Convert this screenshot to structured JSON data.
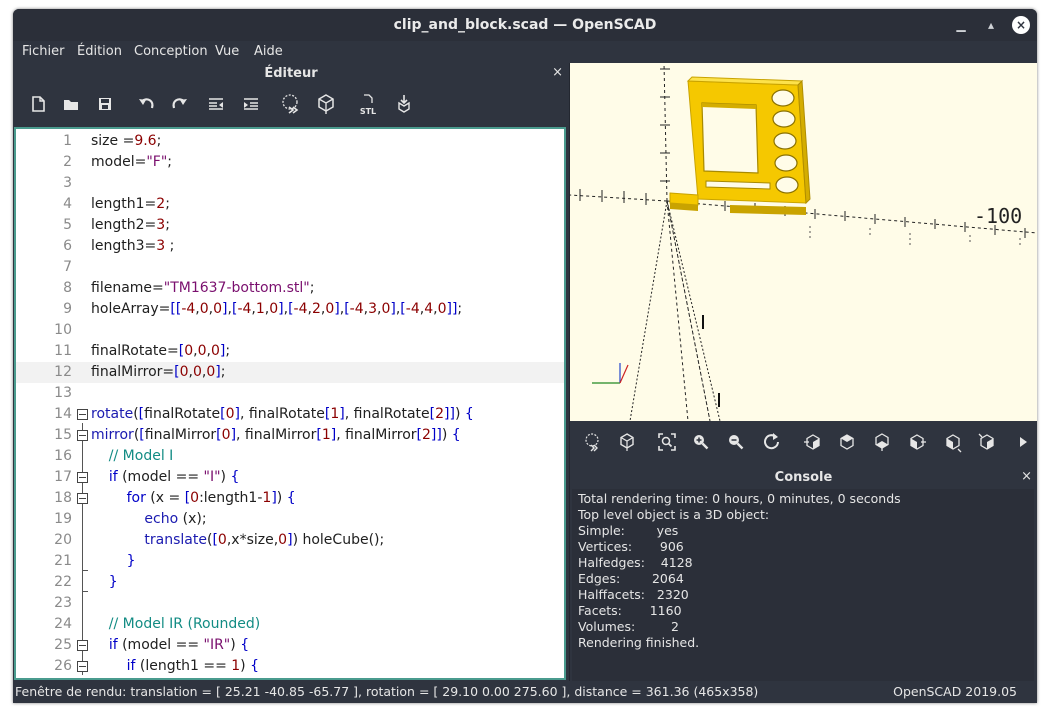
{
  "window": {
    "title": "clip_and_block.scad — OpenSCAD"
  },
  "menu": [
    "Fichier",
    "Édition",
    "Conception",
    "Vue",
    "Aide"
  ],
  "editor": {
    "title": "Éditeur",
    "close": "×",
    "toolbar_icons": [
      "new-file-icon",
      "open-file-icon",
      "save-icon",
      "undo-icon",
      "redo-icon",
      "unindent-icon",
      "indent-icon",
      "preview-icon",
      "render-icon",
      "export-stl-icon",
      "send-to-3d-print-icon"
    ],
    "stl_label": "STL"
  },
  "code_lines": [
    {
      "n": "1",
      "text": "size =9.6;"
    },
    {
      "n": "2",
      "text": "model=\"F\";"
    },
    {
      "n": "3",
      "text": ""
    },
    {
      "n": "4",
      "text": "length1=2;"
    },
    {
      "n": "5",
      "text": "length2=3;"
    },
    {
      "n": "6",
      "text": "length3=3 ;"
    },
    {
      "n": "7",
      "text": ""
    },
    {
      "n": "8",
      "text": "filename=\"TM1637-bottom.stl\";"
    },
    {
      "n": "9",
      "text": "holeArray=[[-4,0,0],[-4,1,0],[-4,2,0],[-4,3,0],[-4,4,0]];"
    },
    {
      "n": "10",
      "text": ""
    },
    {
      "n": "11",
      "text": "finalRotate=[0,0,0];"
    },
    {
      "n": "12",
      "text": "finalMirror=[0,0,0];"
    },
    {
      "n": "13",
      "text": ""
    },
    {
      "n": "14",
      "text": "rotate([finalRotate[0], finalRotate[1], finalRotate[2]]) {"
    },
    {
      "n": "15",
      "text": "mirror([finalMirror[0], finalMirror[1], finalMirror[2]]) {"
    },
    {
      "n": "16",
      "text": "    // Model I"
    },
    {
      "n": "17",
      "text": "    if (model == \"I\") {"
    },
    {
      "n": "18",
      "text": "        for (x = [0:length1-1]) {"
    },
    {
      "n": "19",
      "text": "            echo (x);"
    },
    {
      "n": "20",
      "text": "            translate([0,x*size,0]) holeCube();"
    },
    {
      "n": "21",
      "text": "        }"
    },
    {
      "n": "22",
      "text": "    }"
    },
    {
      "n": "23",
      "text": ""
    },
    {
      "n": "24",
      "text": "    // Model IR (Rounded)"
    },
    {
      "n": "25",
      "text": "    if (model == \"IR\") {"
    },
    {
      "n": "26",
      "text": "        if (length1 == 1) {"
    }
  ],
  "viewport": {
    "axis_label": "-100"
  },
  "view_toolbar_icons": [
    "preview-icon",
    "render-icon",
    "view-all-icon",
    "zoom-in-icon",
    "zoom-out-icon",
    "reset-view-icon",
    "view-right-icon",
    "view-top-icon",
    "view-bottom-icon",
    "view-left-icon",
    "view-front-icon",
    "view-back-icon",
    "more-icon"
  ],
  "console": {
    "title": "Console",
    "close": "×",
    "lines": [
      "Total rendering time: 0 hours, 0 minutes, 0 seconds",
      "Top level object is a 3D object:",
      "Simple:        yes",
      "Vertices:       906",
      "Halfedges:    4128",
      "Edges:        2064",
      "Halffacets:   2320",
      "Facets:       1160",
      "Volumes:         2",
      "Rendering finished."
    ]
  },
  "status": {
    "left": "Fenêtre de rendu: translation = [ 25.21 -40.85 -65.77 ], rotation = [ 29.10 0.00 275.60 ], distance = 361.36 (465x358)",
    "right": "OpenSCAD 2019.05"
  },
  "colors": {
    "model": "#f5c800",
    "model_edge": "#c9a300",
    "viewport_bg": "#fffce8",
    "editor_border": "#4a9b8e",
    "chrome": "#2f343f"
  }
}
